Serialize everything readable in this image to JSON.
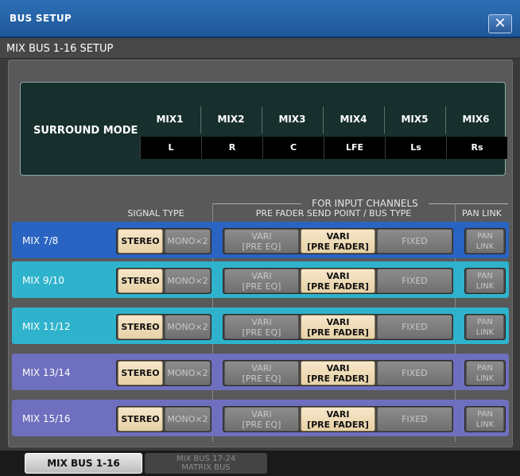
{
  "window": {
    "title": "BUS SETUP",
    "close_icon": "✕",
    "subtitle": "MIX BUS 1-16 SETUP"
  },
  "surround": {
    "label": "SURROUND MODE",
    "mixes": [
      "MIX1",
      "MIX2",
      "MIX3",
      "MIX4",
      "MIX5",
      "MIX6"
    ],
    "channels": [
      "L",
      "R",
      "C",
      "LFE",
      "Ls",
      "Rs"
    ]
  },
  "headers": {
    "signal_type": "SIGNAL TYPE",
    "for_input_channels": "FOR INPUT CHANNELS",
    "pre_fader_send": "PRE FADER SEND POINT / BUS TYPE",
    "pan_link": "PAN LINK"
  },
  "rows": [
    {
      "label": "MIX 7/8",
      "stereo": "STEREO",
      "mono": "MONO×2",
      "vari_pre_eq": [
        "VARI",
        "[PRE EQ]"
      ],
      "vari_pre_fader": [
        "VARI",
        "[PRE FADER]"
      ],
      "fixed": "FIXED",
      "pan_link": [
        "PAN",
        "LINK"
      ]
    },
    {
      "label": "MIX 9/10",
      "stereo": "STEREO",
      "mono": "MONO×2",
      "vari_pre_eq": [
        "VARI",
        "[PRE EQ]"
      ],
      "vari_pre_fader": [
        "VARI",
        "[PRE FADER]"
      ],
      "fixed": "FIXED",
      "pan_link": [
        "PAN",
        "LINK"
      ]
    },
    {
      "label": "MIX 11/12",
      "stereo": "STEREO",
      "mono": "MONO×2",
      "vari_pre_eq": [
        "VARI",
        "[PRE EQ]"
      ],
      "vari_pre_fader": [
        "VARI",
        "[PRE FADER]"
      ],
      "fixed": "FIXED",
      "pan_link": [
        "PAN",
        "LINK"
      ]
    },
    {
      "label": "MIX 13/14",
      "stereo": "STEREO",
      "mono": "MONO×2",
      "vari_pre_eq": [
        "VARI",
        "[PRE EQ]"
      ],
      "vari_pre_fader": [
        "VARI",
        "[PRE FADER]"
      ],
      "fixed": "FIXED",
      "pan_link": [
        "PAN",
        "LINK"
      ]
    },
    {
      "label": "MIX 15/16",
      "stereo": "STEREO",
      "mono": "MONO×2",
      "vari_pre_eq": [
        "VARI",
        "[PRE EQ]"
      ],
      "vari_pre_fader": [
        "VARI",
        "[PRE FADER]"
      ],
      "fixed": "FIXED",
      "pan_link": [
        "PAN",
        "LINK"
      ]
    }
  ],
  "row_colors": [
    "#2a64c2",
    "#2fb3cc",
    "#2fb3cc",
    "#6f6fbf",
    "#6f6fbf"
  ],
  "tabs": {
    "active": "MIX BUS 1-16",
    "inactive_line1": "MIX BUS 17-24",
    "inactive_line2": "MATRIX BUS"
  },
  "colors": {
    "title_bar": "#2566ad",
    "button_on": "#f0dcb4",
    "button_off": "#7c7c7c"
  }
}
